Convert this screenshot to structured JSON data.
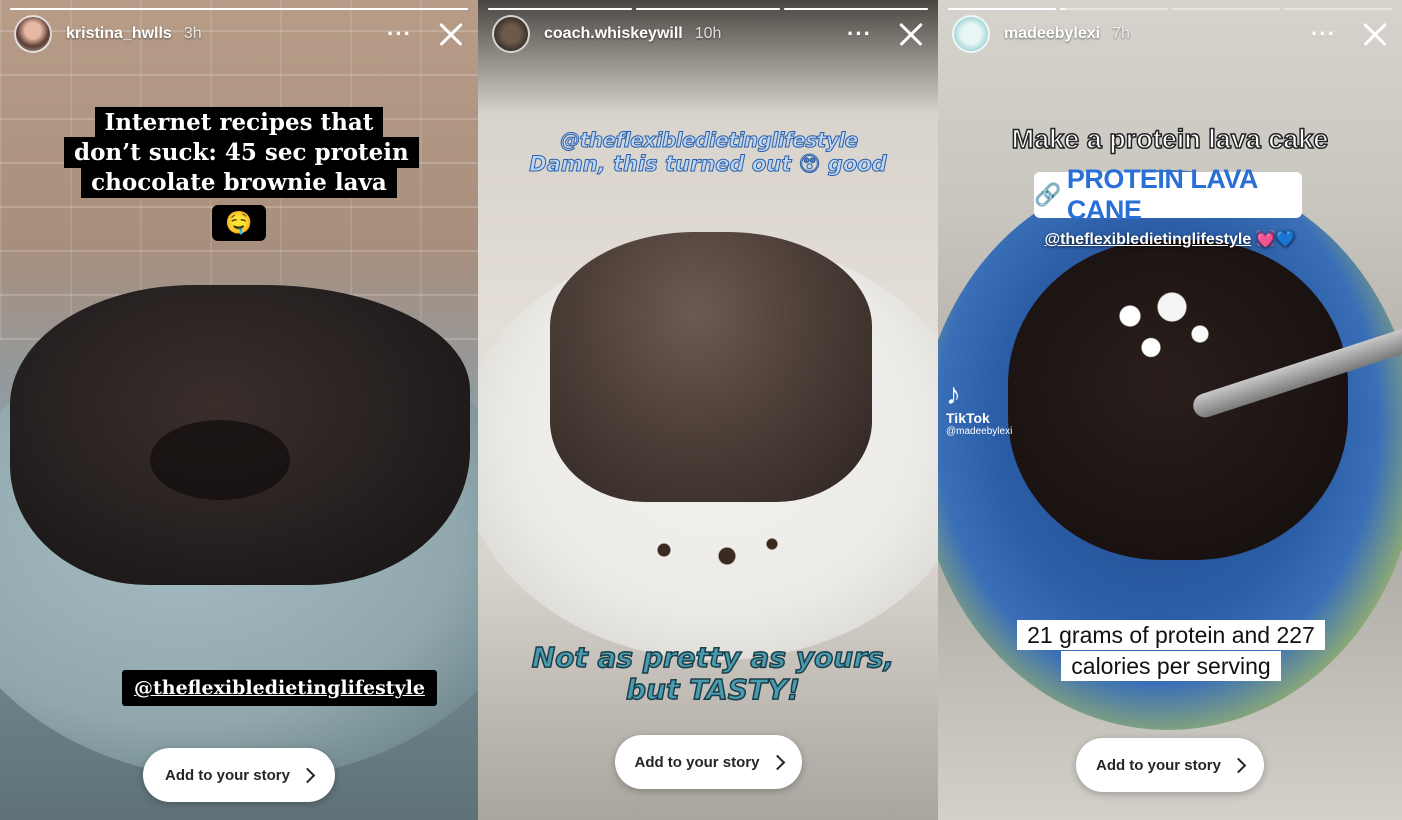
{
  "stories": [
    {
      "username": "kristina_hwlls",
      "time": "3h",
      "progress": [
        1.0
      ],
      "caption": "Internet recipes that don’t suck: 45 sec protein chocolate brownie lava",
      "caption_emoji": "🤤",
      "mention": "@theflexibledietinglifestyle",
      "add_button": "Add to your story"
    },
    {
      "username": "coach.whiskeywill",
      "time": "10h",
      "progress": [
        1.0,
        1.0,
        1.0
      ],
      "mention": "@theflexibledietinglifestyle",
      "caption_line": "Damn, this turned out 😲 good",
      "bottom_text": "Not as pretty as yours, but TASTY!",
      "add_button": "Add to your story"
    },
    {
      "username": "madeebylexi",
      "time": "7h",
      "progress": [
        1.0,
        0.05,
        0.0,
        0.0
      ],
      "title": "Make a protein lava cake",
      "link_sticker": "PROTEIN LAVA CANE",
      "link_icon": "🔗",
      "mention": "@theflexibledietinglifestyle",
      "mention_emojis": "💓💙",
      "tiktok_label": "TikTok",
      "tiktok_handle": "@madeebylexi",
      "stats": "21 grams of protein and 227 calories per serving",
      "add_button": "Add to your story"
    }
  ],
  "icons": {
    "more": "more-options-icon",
    "close": "close-icon",
    "chevron": "chevron-right-icon"
  }
}
